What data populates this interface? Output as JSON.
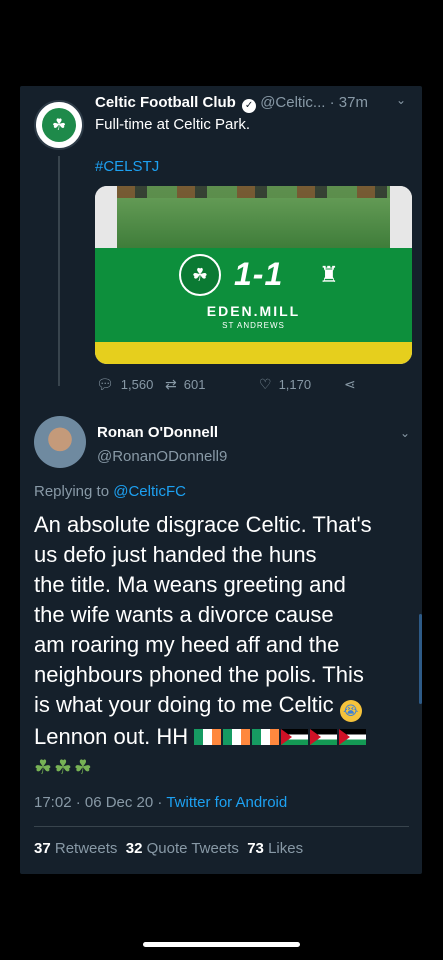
{
  "tweet1": {
    "name": "Celtic Football Club",
    "handle": "@Celtic...",
    "separator": "·",
    "time": "37m",
    "text": "Full-time at Celtic Park.",
    "hashtag": "#CELSTJ",
    "media": {
      "score": "1-1",
      "sponsor": "EDEN.MILL",
      "sponsor_sub": "ST ANDREWS"
    },
    "replies": "1,560",
    "retweets": "601",
    "likes": "1,170"
  },
  "tweet2": {
    "name": "Ronan O'Donnell",
    "handle": "@RonanODonnell9",
    "replying_prefix": "Replying to",
    "replying_to": "@CelticFC",
    "lines": [
      "An absolute disgrace Celtic. That's",
      "us defo just handed the huns",
      "the title. Ma weans greeting and",
      "the wife wants a divorce cause",
      "am roaring my heed aff and the",
      "neighbours phoned the polis. This",
      "is what your doing to me Celtic",
      "Lennon out. HH"
    ],
    "time": "17:02 · 06 Dec 20 ·",
    "source": "Twitter for Android",
    "stats": {
      "retweets_count": "37",
      "retweets_label": "Retweets",
      "quotes_count": "32",
      "quotes_label": "Quote Tweets",
      "likes_count": "73",
      "likes_label": "Likes"
    }
  },
  "colors": {
    "background": "#15202b",
    "accent": "#1da1f2",
    "muted": "#8899a6"
  }
}
